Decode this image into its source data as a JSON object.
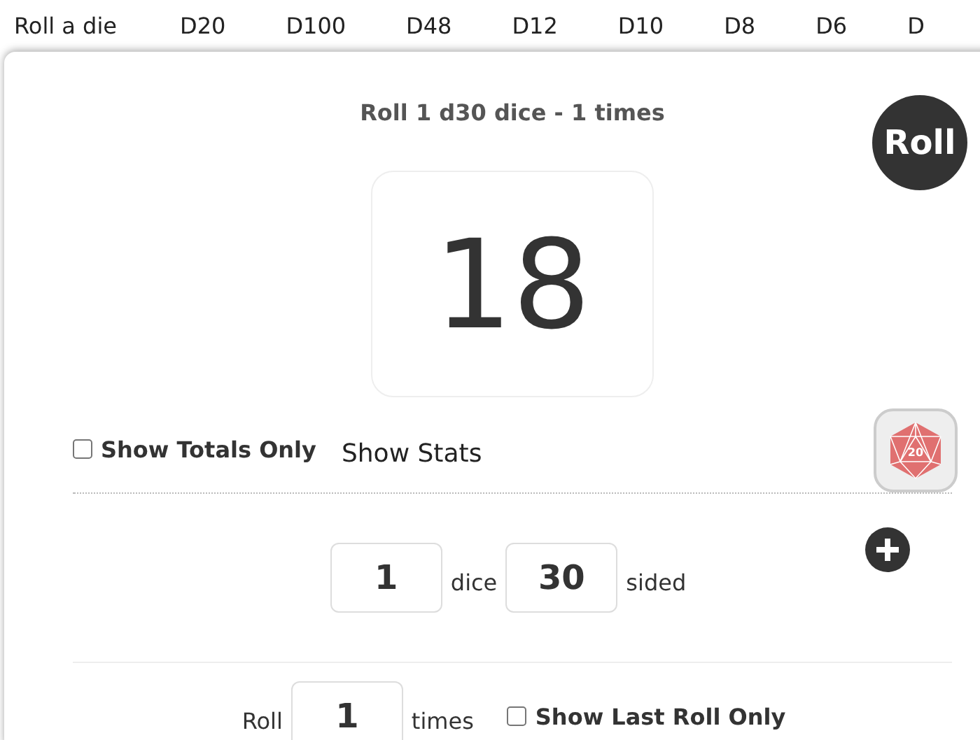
{
  "nav": [
    {
      "label": "Roll a die"
    },
    {
      "label": "D20"
    },
    {
      "label": "D100"
    },
    {
      "label": "D48"
    },
    {
      "label": "D12"
    },
    {
      "label": "D10"
    },
    {
      "label": "D8"
    },
    {
      "label": "D6"
    },
    {
      "label": "D"
    }
  ],
  "title": "Roll 1 d30 dice - 1 times",
  "roll_button": "Roll",
  "result": "18",
  "show_totals_only": {
    "label": "Show Totals Only",
    "checked": false
  },
  "show_stats": "Show Stats",
  "die_icon_label": "20",
  "dice": {
    "count": "1",
    "count_label": "dice",
    "sides": "30",
    "sides_label": "sided"
  },
  "times": {
    "label": "Roll",
    "value": "1",
    "suffix": "times"
  },
  "show_last_roll_only": {
    "label": "Show Last Roll Only",
    "checked": false
  }
}
